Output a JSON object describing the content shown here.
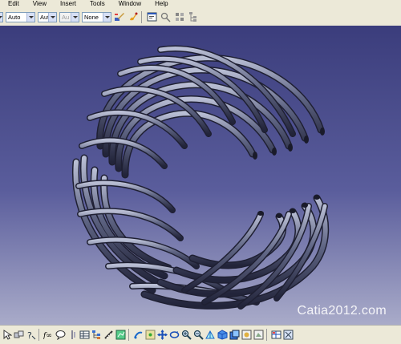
{
  "menu": {
    "items": [
      {
        "label": "Edit"
      },
      {
        "label": "View"
      },
      {
        "label": "Insert"
      },
      {
        "label": "Tools"
      },
      {
        "label": "Window"
      },
      {
        "label": "Help"
      }
    ]
  },
  "toolbar": {
    "color_value": "",
    "transparency_value": "Auto",
    "linetype_value": "Aut",
    "lineweight_value": "Au",
    "layer_value": "None",
    "icons_top": [
      "painter-icon",
      "brush-icon",
      "properties-icon",
      "pattern-icon",
      "apply-icon",
      "tree-icon"
    ]
  },
  "viewport": {
    "background_top": "#3b3d7c",
    "background_bottom": "#a9abc9",
    "model_color": "#6e7490",
    "watermark": "Catia2012.com"
  },
  "bottom_toolbar": {
    "icons": [
      "pointer-icon",
      "snap-icon",
      "help-icon",
      "formula-icon",
      "comment-icon",
      "split-icon",
      "table-icon",
      "tree-expand-icon",
      "measure-icon",
      "analysis-icon",
      "spec-icon",
      "pan-icon",
      "rotate-icon",
      "zoom-in-icon",
      "zoom-out-icon",
      "normal-view-icon",
      "iso-view-icon",
      "shading-icon",
      "hide-icon",
      "swap-icon",
      "apply-material-icon",
      "multi-view-icon"
    ]
  }
}
